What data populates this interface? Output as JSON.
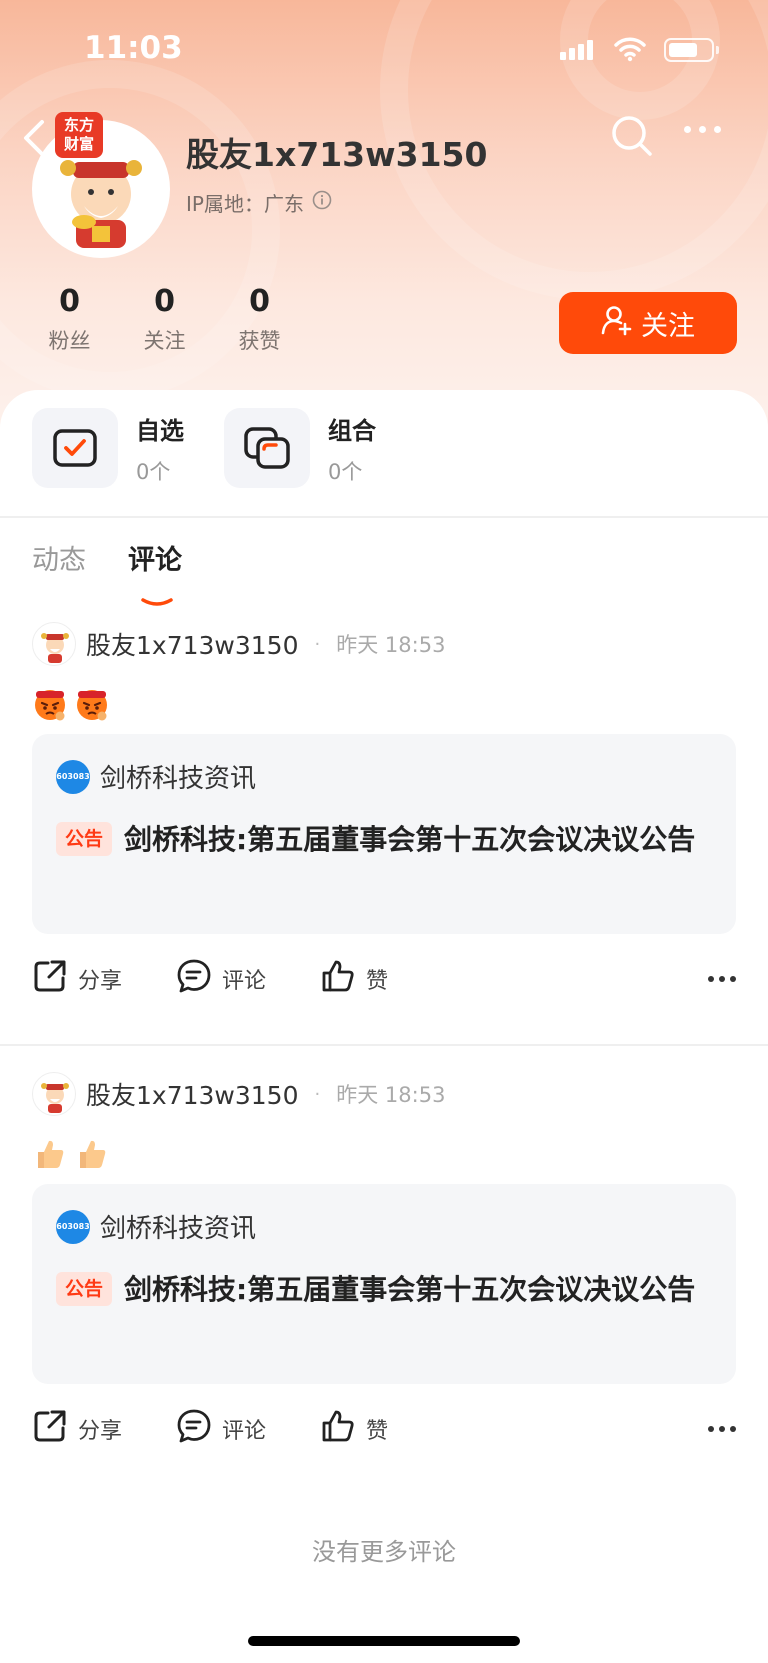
{
  "status": {
    "time": "11:03"
  },
  "profile": {
    "badge_line1": "东方",
    "badge_line2": "财富",
    "username": "股友1x713w3150",
    "ip_label": "IP属地：广东",
    "stats": [
      {
        "value": "0",
        "label": "粉丝"
      },
      {
        "value": "0",
        "label": "关注"
      },
      {
        "value": "0",
        "label": "获赞"
      }
    ],
    "follow_label": "关注"
  },
  "quick": [
    {
      "title": "自选",
      "count": "0个",
      "icon": "checkbox-icon"
    },
    {
      "title": "组合",
      "count": "0个",
      "icon": "stack-icon"
    }
  ],
  "tabs": [
    {
      "label": "动态",
      "active": false
    },
    {
      "label": "评论",
      "active": true
    }
  ],
  "posts": [
    {
      "author": "股友1x713w3150",
      "dot": "·",
      "time": "昨天 18:53",
      "emojis": [
        "angry-face-emoji",
        "angry-face-emoji"
      ],
      "card": {
        "stock_code": "603083",
        "source": "剑桥科技资讯",
        "tag": "公告",
        "title": "剑桥科技:第五届董事会第十五次会议决议公告"
      },
      "actions": {
        "share": "分享",
        "comment": "评论",
        "like": "赞"
      }
    },
    {
      "author": "股友1x713w3150",
      "dot": "·",
      "time": "昨天 18:53",
      "emojis": [
        "thumbs-up-emoji",
        "thumbs-up-emoji"
      ],
      "card": {
        "stock_code": "603083",
        "source": "剑桥科技资讯",
        "tag": "公告",
        "title": "剑桥科技:第五届董事会第十五次会议决议公告"
      },
      "actions": {
        "share": "分享",
        "comment": "评论",
        "like": "赞"
      }
    }
  ],
  "footer": {
    "no_more": "没有更多评论"
  },
  "colors": {
    "accent": "#ff4a0a",
    "tag_bg": "#ffe3dc",
    "tag_text": "#ff3a14",
    "stock_badge": "#1e88e5"
  }
}
